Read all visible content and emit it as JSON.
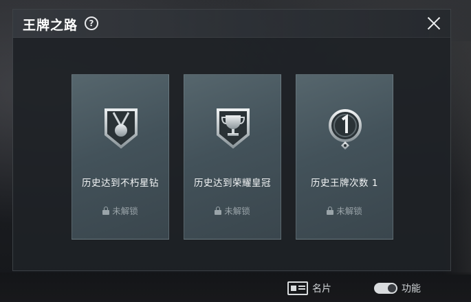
{
  "dialog": {
    "title": "王牌之路",
    "help_icon": "help-icon",
    "close_icon": "close-icon"
  },
  "achievements": [
    {
      "label": "历史达到不朽星钻",
      "icon": "medal-badge-icon",
      "status": "未解锁"
    },
    {
      "label": "历史达到荣耀皇冠",
      "icon": "trophy-badge-icon",
      "status": "未解锁"
    },
    {
      "label": "历史王牌次数 1",
      "icon": "number-one-badge-icon",
      "status": "未解锁"
    }
  ],
  "bottom_bar": {
    "card_label": "名片",
    "toggle_label": "功能"
  }
}
